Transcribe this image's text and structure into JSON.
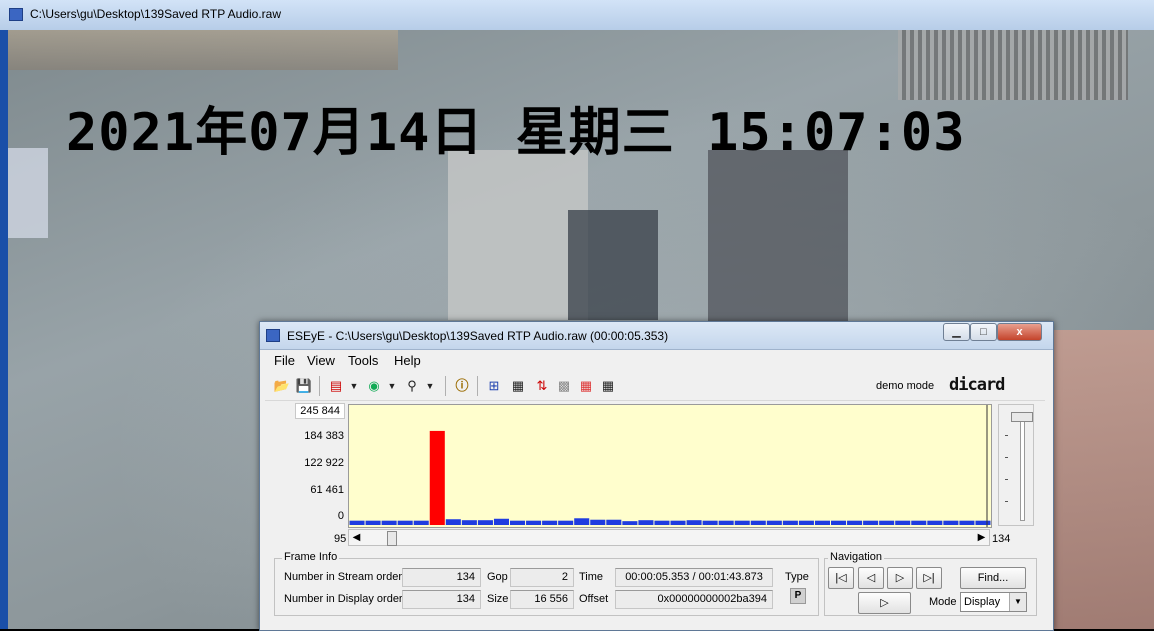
{
  "outer_window": {
    "title": "C:\\Users\\gu\\Desktop\\139Saved RTP Audio.raw"
  },
  "video": {
    "osd_text": "2021年07月14日  星期三 15:07:03"
  },
  "window": {
    "title": "ESEyE - C:\\Users\\gu\\Desktop\\139Saved RTP Audio.raw (00:00:05.353)",
    "close_glyph": "x",
    "menu": [
      "File",
      "View",
      "Tools",
      "Help"
    ],
    "demo_mode": "demo mode",
    "brand": "dicard"
  },
  "chart_data": {
    "type": "bar",
    "y_tick_labels": [
      "245 844",
      "184 383",
      "122 922",
      "61 461",
      "0"
    ],
    "ylim": [
      0,
      245844
    ],
    "x_range_labels": [
      "95",
      "134"
    ],
    "colors": {
      "normal": "#1f3ce0",
      "selected": "#ff0000",
      "background": "#fffecd"
    },
    "values": [
      9000,
      9000,
      9000,
      9000,
      9000,
      196000,
      12000,
      10000,
      10000,
      13000,
      9000,
      9000,
      9000,
      9000,
      14000,
      11000,
      11000,
      8000,
      10000,
      9000,
      9000,
      10000,
      9000,
      9000,
      9000,
      9000,
      9000,
      9000,
      9000,
      9000,
      9000,
      9000,
      9000,
      9000,
      9000,
      9000,
      9000,
      9000,
      9000,
      9000
    ],
    "selected_index": 5
  },
  "frame_info": {
    "title": "Frame Info",
    "number_stream_label": "Number in Stream order",
    "number_stream": "134",
    "number_display_label": "Number in Display order",
    "number_display": "134",
    "gop_label": "Gop",
    "gop": "2",
    "size_label": "Size",
    "size": "16 556",
    "time_label": "Time",
    "time": "00:00:05.353 / 00:01:43.873",
    "offset_label": "Offset",
    "offset": "0x00000000002ba394",
    "type_label": "Type",
    "type": "P"
  },
  "navigation": {
    "title": "Navigation",
    "first": "|◁",
    "prev": "◁",
    "next": "▷",
    "last": "▷|",
    "play": "▷",
    "find": "Find...",
    "mode_label": "Mode",
    "mode": "Display"
  },
  "icons": [
    "folder-open-icon",
    "save-icon",
    "chart-icon",
    "color-wheel-icon",
    "zoom-icon",
    "info-icon",
    "grid-lines-icon",
    "table-icon",
    "arrows-icon",
    "tiles-icon",
    "color-grid-icon",
    "grid-icon"
  ]
}
